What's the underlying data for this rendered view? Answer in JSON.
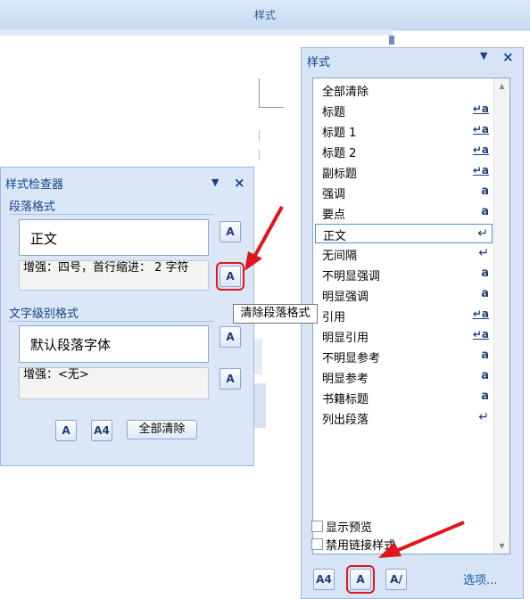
{
  "ribbon": {
    "group_label": "样式"
  },
  "styles_pane": {
    "title": "样式",
    "dropdown_glyph": "▼",
    "close_glyph": "×",
    "items": [
      {
        "label": "全部清除",
        "mark": ""
      },
      {
        "label": "标题",
        "mark": "↵a",
        "kind": "linked"
      },
      {
        "label": "标题 1",
        "mark": "↵a",
        "kind": "linked"
      },
      {
        "label": "标题 2",
        "mark": "↵a",
        "kind": "linked"
      },
      {
        "label": "副标题",
        "mark": "↵a",
        "kind": "linked"
      },
      {
        "label": "强调",
        "mark": "a",
        "kind": "character"
      },
      {
        "label": "要点",
        "mark": "a",
        "kind": "character"
      },
      {
        "label": "正文",
        "mark": "↵",
        "kind": "paragraph",
        "selected": true
      },
      {
        "label": "无间隔",
        "mark": "↵",
        "kind": "paragraph"
      },
      {
        "label": "不明显强调",
        "mark": "a",
        "kind": "character"
      },
      {
        "label": "明显强调",
        "mark": "a",
        "kind": "character"
      },
      {
        "label": "引用",
        "mark": "↵a",
        "kind": "linked"
      },
      {
        "label": "明显引用",
        "mark": "↵a",
        "kind": "linked"
      },
      {
        "label": "不明显参考",
        "mark": "a",
        "kind": "character"
      },
      {
        "label": "明显参考",
        "mark": "a",
        "kind": "character"
      },
      {
        "label": "书籍标题",
        "mark": "a",
        "kind": "character"
      },
      {
        "label": "列出段落",
        "mark": "↵",
        "kind": "paragraph"
      }
    ],
    "show_preview_label": "显示预览",
    "disable_linked_label": "禁用链接样式",
    "show_preview_checked": false,
    "disable_linked_checked": false,
    "options_link": "选项...",
    "bottom_buttons": [
      {
        "name": "new-style-button",
        "glyph": "A4"
      },
      {
        "name": "style-inspector-button",
        "glyph": "A"
      },
      {
        "name": "manage-styles-button",
        "glyph": "A/"
      }
    ]
  },
  "inspector": {
    "title": "样式检查器",
    "dropdown_glyph": "▼",
    "close_glyph": "×",
    "paragraph_section": "段落格式",
    "paragraph_value": "正文",
    "paragraph_plus": "增强：四号，首行缩进： 2 字符",
    "text_section": "文字级别格式",
    "text_value": "默认段落字体",
    "text_plus": "增强：<无>",
    "clear_all_label": "全部清除",
    "tooltip": "清除段落格式"
  },
  "colors": {
    "highlight_red": "#e0161c",
    "title_blue": "#15428b",
    "selection_border": "#4a90d9"
  }
}
